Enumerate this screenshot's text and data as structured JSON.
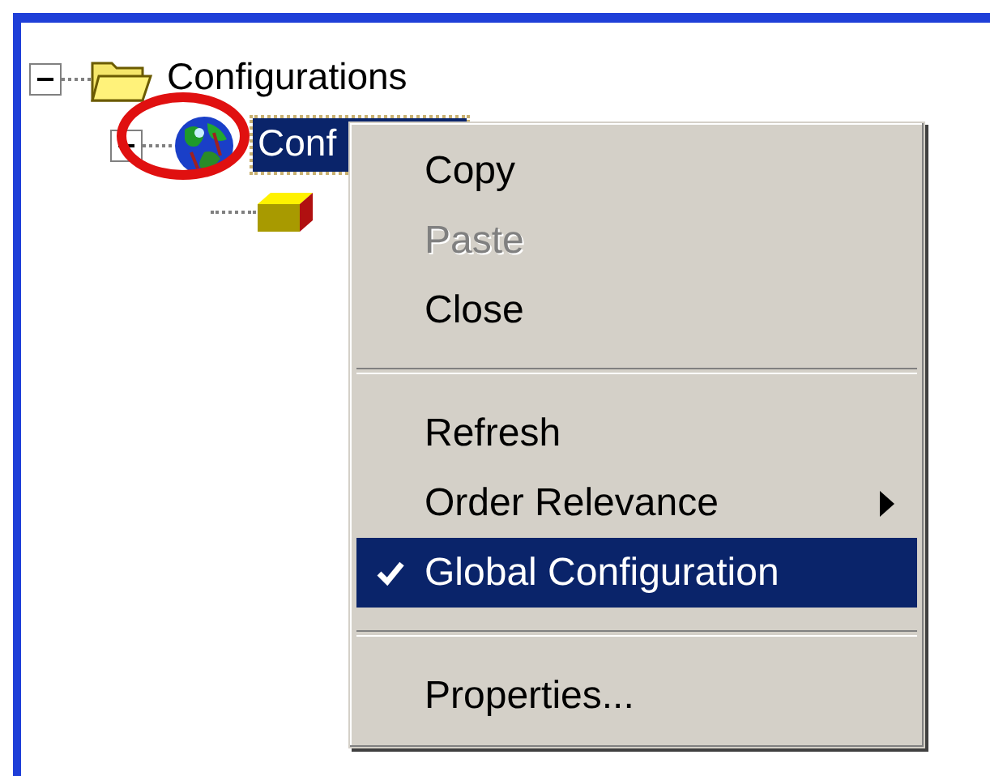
{
  "tree": [
    {
      "label": "Configurations",
      "kind": "folder",
      "expanded": true,
      "selected": false,
      "children": [
        {
          "label": "Conf",
          "kind": "globe",
          "expanded": true,
          "selected": true,
          "children": [
            {
              "kind": "cube"
            }
          ]
        }
      ]
    }
  ],
  "annotation": {
    "kind": "circle"
  },
  "context_menu": [
    {
      "kind": "item",
      "label": "Copy",
      "disabled": false,
      "checked": false,
      "submenu": false,
      "selected": false
    },
    {
      "kind": "item",
      "label": "Paste",
      "disabled": true,
      "checked": false,
      "submenu": false,
      "selected": false
    },
    {
      "kind": "item",
      "label": "Close",
      "disabled": false,
      "checked": false,
      "submenu": false,
      "selected": false
    },
    {
      "kind": "separator"
    },
    {
      "kind": "item",
      "label": "Refresh",
      "disabled": false,
      "checked": false,
      "submenu": false,
      "selected": false
    },
    {
      "kind": "item",
      "label": "Order Relevance",
      "disabled": false,
      "checked": false,
      "submenu": true,
      "selected": false
    },
    {
      "kind": "item",
      "label": "Global Configuration",
      "disabled": false,
      "checked": true,
      "submenu": false,
      "selected": true
    },
    {
      "kind": "separator"
    },
    {
      "kind": "item",
      "label": "Properties...",
      "disabled": false,
      "checked": false,
      "submenu": false,
      "selected": false
    }
  ]
}
